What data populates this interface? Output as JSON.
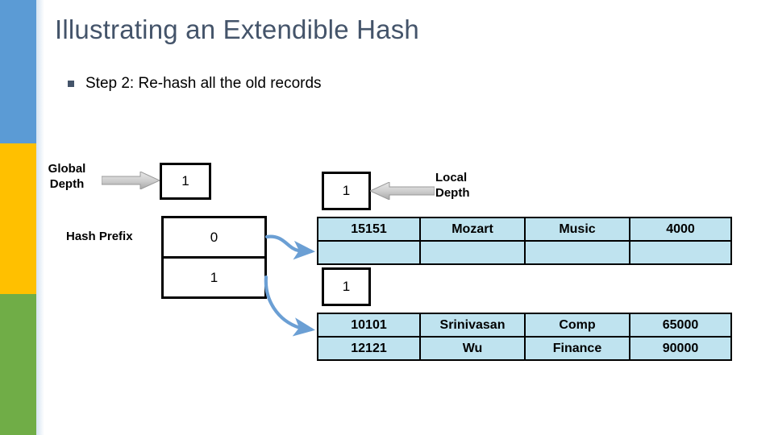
{
  "slide": {
    "title": "Illustrating an Extendible Hash",
    "bullet": {
      "marker": "square-bullet",
      "text": "Step 2: Re-hash all the old records"
    }
  },
  "colors": {
    "rail_blue": "#5b9bd5",
    "rail_yellow": "#ffc000",
    "rail_green": "#70ad47",
    "title": "#44546a",
    "bucket_fill": "#bfe3ef",
    "arrow_blue": "#5b9bd5",
    "arrow_gray": "#bfbfbf"
  },
  "labels": {
    "global_depth": "Global\nDepth",
    "global_depth_line1": "Global",
    "global_depth_line2": "Depth",
    "hash_prefix": "Hash Prefix",
    "local_depth_line1": "Local",
    "local_depth_line2": "Depth"
  },
  "global_depth": {
    "value": "1"
  },
  "directory": {
    "name": "hash-prefix-directory",
    "entries": [
      "0",
      "1"
    ]
  },
  "buckets": [
    {
      "name": "bucket-0",
      "local_depth": "1",
      "rows": [
        [
          "15151",
          "Mozart",
          "Music",
          "4000"
        ],
        [
          "",
          "",
          "",
          ""
        ]
      ]
    },
    {
      "name": "bucket-1",
      "local_depth": "1",
      "rows": [
        [
          "10101",
          "Srinivasan",
          "Comp",
          "65000"
        ],
        [
          "12121",
          "Wu",
          "Finance",
          "90000"
        ]
      ]
    }
  ]
}
